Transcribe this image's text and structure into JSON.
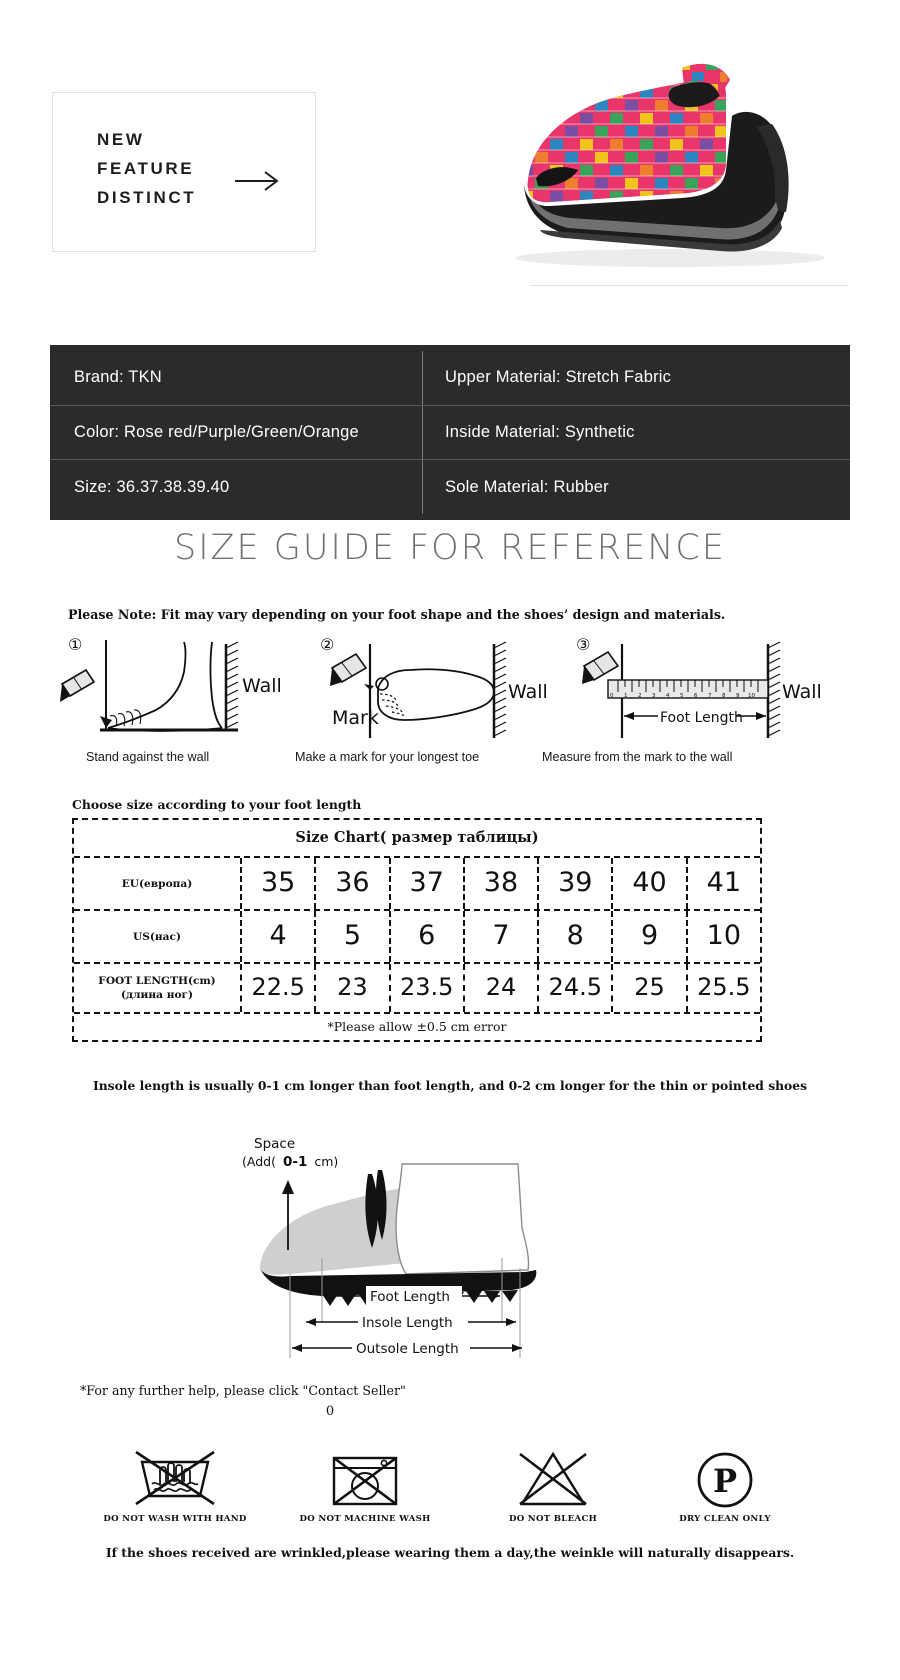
{
  "hero": {
    "line1": "NEW",
    "line2": "FEATURE",
    "line3": "DISTINCT",
    "arrow_icon": "arrow-right-icon",
    "product_icon": "woven-wedge-shoe"
  },
  "spec": {
    "rows": [
      {
        "left": "Brand: TKN",
        "right": "Upper  Material:  Stretch  Fabric"
      },
      {
        "left": "Color: Rose  red/Purple/Green/Orange",
        "right": "Inside  Material:  Synthetic"
      },
      {
        "left": "Size:  36.37.38.39.40",
        "right": "Sole  Material:  Rubber"
      }
    ]
  },
  "guide": {
    "title": "SIZE GUIDE FOR REFERENCE",
    "note": "Please Note:  Fit may vary depending on your foot shape and the shoes’ design and materials.",
    "steps": [
      {
        "number": "①",
        "wall": "Wall",
        "mark": "",
        "caption": "Stand against the wall"
      },
      {
        "number": "②",
        "wall": "Wall",
        "mark": "Mark",
        "caption": "Make a mark for your longest toe"
      },
      {
        "number": "③",
        "wall": "Wall",
        "mark": "Foot Length",
        "caption": "Measure from the mark to the wall"
      }
    ],
    "ruler_ticks": [
      "0",
      "1",
      "2",
      "3",
      "4",
      "5",
      "6",
      "7",
      "8",
      "9",
      "10"
    ]
  },
  "chart": {
    "choose_label": "Choose size according to your foot length",
    "title": "Size Chart( размер таблицы)",
    "footnote": "*Please allow ±0.5 cm error",
    "rows": [
      {
        "header": "EU(европа)",
        "header2": "",
        "values": [
          "35",
          "36",
          "37",
          "38",
          "39",
          "40",
          "41"
        ]
      },
      {
        "header": "US(нас)",
        "header2": "",
        "values": [
          "4",
          "5",
          "6",
          "7",
          "8",
          "9",
          "10"
        ]
      },
      {
        "header": "FOOT LENGTH(cm)",
        "header2": "(длина ног)",
        "values": [
          "22.5",
          "23",
          "23.5",
          "24",
          "24.5",
          "25",
          "25.5"
        ]
      }
    ]
  },
  "chart_data": {
    "type": "table",
    "title": "Size Chart( размер таблицы)",
    "categories": [
      "35",
      "36",
      "37",
      "38",
      "39",
      "40",
      "41"
    ],
    "series": [
      {
        "name": "EU(европа)",
        "values": [
          35,
          36,
          37,
          38,
          39,
          40,
          41
        ]
      },
      {
        "name": "US(нас)",
        "values": [
          4,
          5,
          6,
          7,
          8,
          9,
          10
        ]
      },
      {
        "name": "FOOT LENGTH(cm) (длина ног)",
        "values": [
          22.5,
          23,
          23.5,
          24,
          24.5,
          25,
          25.5
        ]
      }
    ],
    "xlabel": "",
    "ylabel": "",
    "annotations": [
      "*Please allow ±0.5 cm error"
    ]
  },
  "insole": {
    "note": "Insole length is usually 0-1 cm longer than foot length, and 0-2 cm longer for the thin or pointed shoes",
    "space_label": "Space",
    "space_add_prefix": "(Add(",
    "space_add_value": "0-1",
    "space_add_suffix": "cm)",
    "dim_foot": "Foot Length",
    "dim_insole": "Insole Length",
    "dim_outsole": "Outsole Length"
  },
  "footer": {
    "help": "*For any further help, please click \"Contact Seller\"",
    "zero": "0",
    "care": [
      {
        "icon": "no-hand-wash-icon",
        "label": "DO NOT WASH WITH HAND"
      },
      {
        "icon": "no-machine-wash-icon",
        "label": "DO NOT MACHINE WASH"
      },
      {
        "icon": "no-bleach-icon",
        "label": "DO NOT BLEACH"
      },
      {
        "icon": "dry-clean-only-icon",
        "label": "DRY CLEAN ONLY"
      }
    ],
    "wrinkle": "If the shoes received are wrinkled,please wearing them a day,the weinkle will naturally disappears."
  }
}
